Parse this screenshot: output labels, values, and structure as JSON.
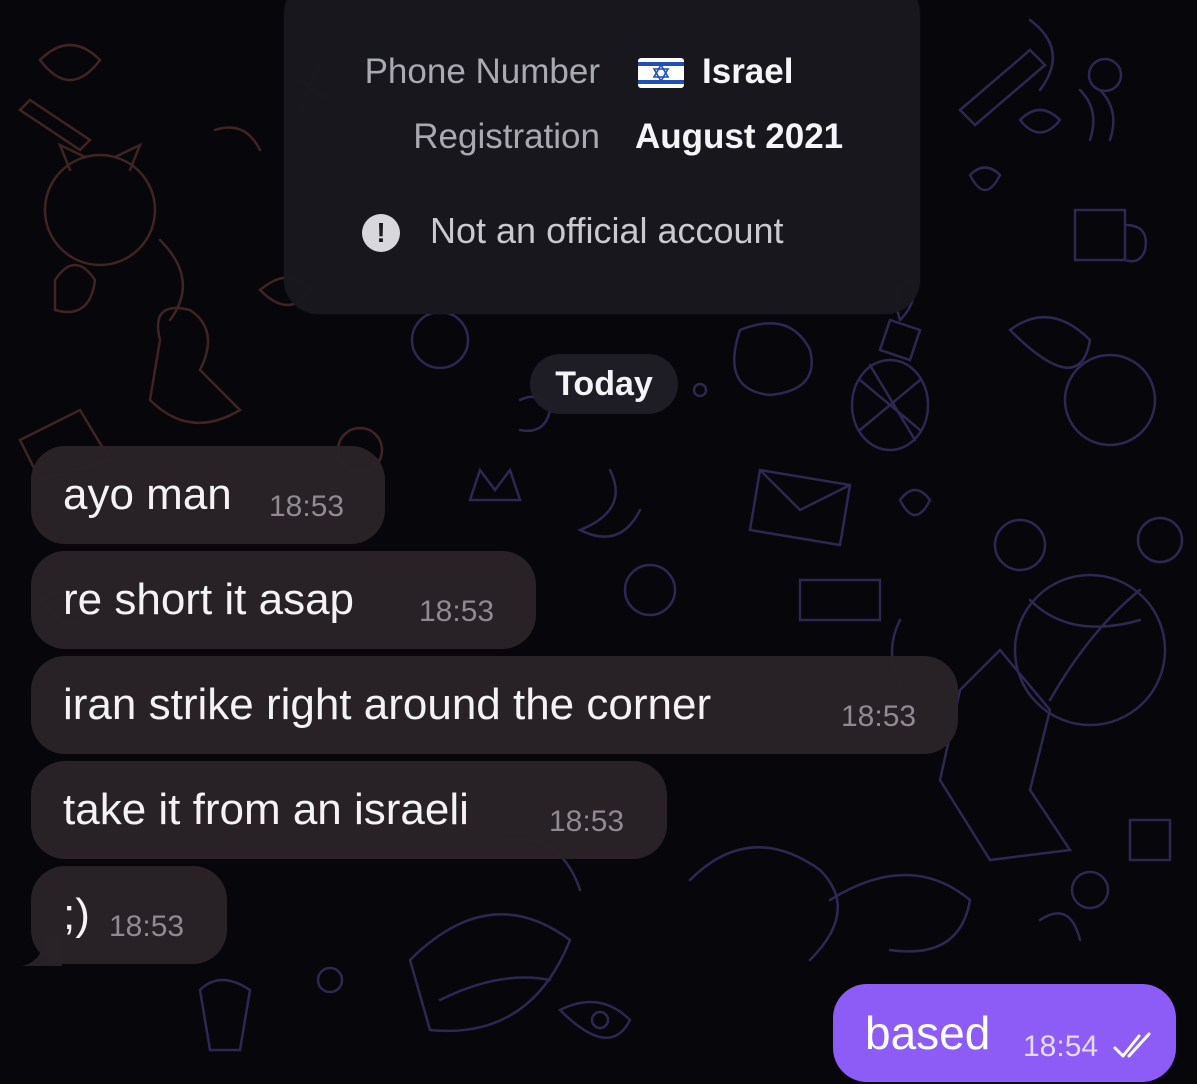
{
  "profile_card": {
    "phone_label": "Phone Number",
    "phone_value": "Israel",
    "registration_label": "Registration",
    "registration_value": "August 2021",
    "notice": "Not an official account"
  },
  "date_divider": "Today",
  "messages_in": [
    {
      "text": "ayo man",
      "time": "18:53"
    },
    {
      "text": "re short it asap",
      "time": "18:53"
    },
    {
      "text": "iran strike right around the corner",
      "time": "18:53"
    },
    {
      "text": "take it from an israeli",
      "time": "18:53"
    },
    {
      "text": ";)",
      "time": "18:53"
    }
  ],
  "message_out": {
    "text": "based",
    "time": "18:54",
    "status": "read"
  },
  "colors": {
    "outgoing_bubble": "#8d5cf6",
    "incoming_bubble": "#2a2228",
    "background": "#07060b"
  },
  "icons": [
    "israel-flag-icon",
    "warning-icon",
    "double-check-icon"
  ]
}
